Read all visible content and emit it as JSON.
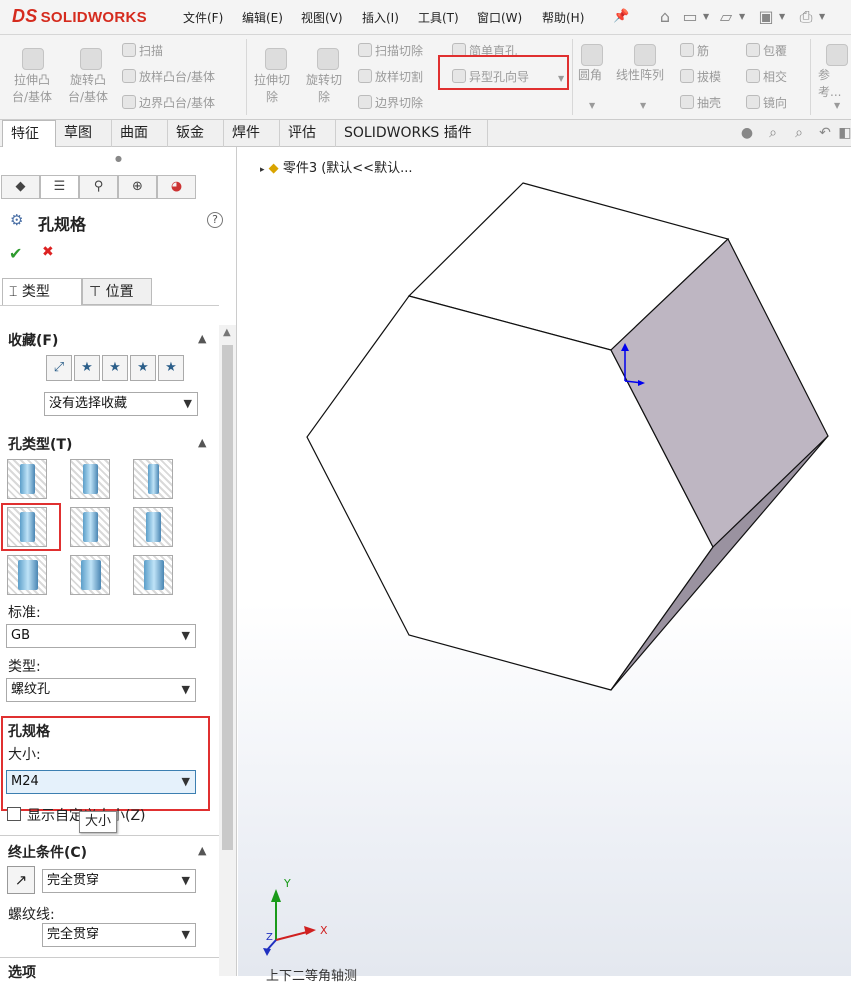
{
  "menubar": {
    "logo_ds": "DS",
    "logo_text": "SOLIDWORKS",
    "items": [
      "文件(F)",
      "编辑(E)",
      "视图(V)",
      "插入(I)",
      "工具(T)",
      "窗口(W)",
      "帮助(H)"
    ]
  },
  "ribbon": {
    "extrude_boss": "拉伸凸\n台/基体",
    "revolve_boss": "旋转凸\n台/基体",
    "sweep": "扫描",
    "loft_boss": "放样凸台/基体",
    "boundary_boss": "边界凸台/基体",
    "extrude_cut": "拉伸切\n除",
    "revolve_cut": "旋转切\n除",
    "swept_cut": "扫描切除",
    "lofted_cut": "放样切割",
    "boundary_cut": "边界切除",
    "simple_hole": "简单直孔",
    "hole_wizard": "异型孔向导",
    "fillet": "圆角",
    "linear_pattern": "线性阵列",
    "rib": "筋",
    "draft": "拔模",
    "shell": "抽壳",
    "wrap": "包覆",
    "intersect": "相交",
    "mirror": "镜向",
    "reference": "参考..."
  },
  "tabs": [
    "特征",
    "草图",
    "曲面",
    "钣金",
    "焊件",
    "评估",
    "SOLIDWORKS 插件"
  ],
  "panel": {
    "title": "孔规格",
    "help": "?",
    "ok": "✔",
    "cancel": "✖",
    "tab_type": "类型",
    "tab_position": "位置",
    "favorites_title": "收藏(F)",
    "favorites_select": "没有选择收藏",
    "hole_type_title": "孔类型(T)",
    "standard_label": "标准:",
    "standard_value": "GB",
    "type_label": "类型:",
    "type_value": "螺纹孔",
    "hole_spec_title": "孔规格",
    "size_label": "大小:",
    "size_value": "M24",
    "custom_size_label": "显示自定义大小(Z)",
    "tooltip": "大小",
    "end_condition_title": "终止条件(C)",
    "end_condition_value": "完全贯穿",
    "thread_label": "螺纹线:",
    "thread_value": "完全贯穿",
    "options_title": "选项"
  },
  "view": {
    "tree_label": "零件3  (默认<<默认...",
    "bottom_label": "上下二等角轴测",
    "triad_x": "X",
    "triad_y": "Y",
    "triad_z": "Z"
  },
  "colors": {
    "accent_red": "#e03030",
    "brand_red": "#d52b1e",
    "face_shaded": "#beb6c2",
    "face_dark": "#9a92a0"
  }
}
